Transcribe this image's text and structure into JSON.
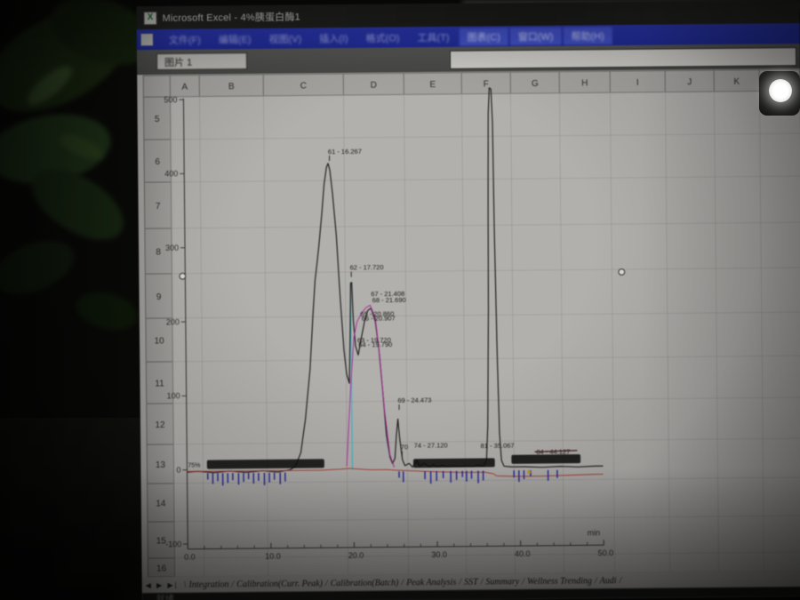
{
  "window": {
    "title": "Microsoft Excel - 4%胰蛋白酶1",
    "status_ready": "就绪",
    "name_box": "图片 1"
  },
  "menu": {
    "items": [
      "文件(F)",
      "编辑(E)",
      "视图(V)",
      "插入(I)",
      "格式(O)",
      "工具(T)",
      "图表(C)",
      "窗口(W)",
      "帮助(H)"
    ]
  },
  "grid": {
    "columns": [
      "A",
      "B",
      "C",
      "D",
      "E",
      "F",
      "G",
      "H",
      "I",
      "J",
      "K"
    ],
    "rows": [
      "5",
      "6",
      "7",
      "8",
      "9",
      "10",
      "11",
      "12",
      "13",
      "14",
      "15",
      "16"
    ]
  },
  "sheet_tabs": {
    "nav": "◀ ▶ ▶|",
    "lead": "\\",
    "separator": "/",
    "tabs": [
      "Integration",
      "Calibration(Curr. Peak)",
      "Calibration(Batch)",
      "Peak Analysis",
      "SST",
      "Summary",
      "Wellness Trending",
      "Audi"
    ]
  },
  "chart_data": {
    "type": "line",
    "title": "",
    "xlabel": "min",
    "ylabel": "",
    "xlim": [
      0,
      50
    ],
    "ylim": [
      -100,
      500
    ],
    "x_ticks": [
      {
        "v": 0,
        "label": "0.0"
      },
      {
        "v": 10,
        "label": "10.0"
      },
      {
        "v": 20,
        "label": "20.0"
      },
      {
        "v": 30,
        "label": "30.0"
      },
      {
        "v": 40,
        "label": "40.0"
      },
      {
        "v": 50,
        "label": "50.0"
      }
    ],
    "y_ticks": [
      {
        "v": 500,
        "label": "500"
      },
      {
        "v": 400,
        "label": "400"
      },
      {
        "v": 300,
        "label": "300"
      },
      {
        "v": 200,
        "label": "200"
      },
      {
        "v": 100,
        "label": "100"
      },
      {
        "v": 0,
        "label": "0"
      },
      {
        "v": -100,
        "label": "-100"
      }
    ],
    "baseline_fragment_label": "75%",
    "peak_labels": [
      {
        "text": "61 - 16.267",
        "x": 17.3,
        "y": 425,
        "leader": true
      },
      {
        "text": "62 - 17.720",
        "x": 19.8,
        "y": 268,
        "leader": true
      },
      {
        "text": "67 - 21.408",
        "x": 22.3,
        "y": 232
      },
      {
        "text": "68 - 21.690",
        "x": 22.45,
        "y": 224
      },
      {
        "text": "65 - 20.860",
        "x": 21.0,
        "y": 205
      },
      {
        "text": "66 - 20.907",
        "x": 21.15,
        "y": 199
      },
      {
        "text": "63 - 19.720",
        "x": 20.6,
        "y": 170
      },
      {
        "text": "64 - 19.790",
        "x": 20.75,
        "y": 164
      },
      {
        "text": "69 - 24.473",
        "x": 25.4,
        "y": 88,
        "leader": true
      },
      {
        "text": "70",
        "x": 25.7,
        "y": 25,
        "leader": true
      },
      {
        "text": "74 - 27.120",
        "x": 27.3,
        "y": 27
      },
      {
        "text": "81 - 35.067",
        "x": 35.3,
        "y": 26
      },
      {
        "text": "84 - 44.127",
        "x": 42.0,
        "y": 17,
        "strike": true
      }
    ],
    "series": [
      {
        "name": "main-trace",
        "color": "#22201e",
        "width": 1.2,
        "points": [
          [
            0,
            -3
          ],
          [
            1.3,
            -2
          ],
          [
            3.2,
            -4
          ],
          [
            5.1,
            -2
          ],
          [
            7.1,
            -4
          ],
          [
            9.1,
            -2
          ],
          [
            10.9,
            -4
          ],
          [
            12.4,
            -1
          ],
          [
            13.0,
            3
          ],
          [
            13.7,
            22
          ],
          [
            14.3,
            68
          ],
          [
            14.9,
            135
          ],
          [
            15.3,
            206
          ],
          [
            15.6,
            254
          ],
          [
            15.9,
            281
          ],
          [
            16.1,
            301
          ],
          [
            16.5,
            345
          ],
          [
            16.8,
            384
          ],
          [
            17.1,
            407
          ],
          [
            17.3,
            412
          ],
          [
            17.5,
            403
          ],
          [
            17.8,
            371
          ],
          [
            18.2,
            315
          ],
          [
            18.6,
            231
          ],
          [
            19.0,
            160
          ],
          [
            19.3,
            127
          ],
          [
            19.6,
            115
          ],
          [
            19.75,
            180
          ],
          [
            19.87,
            250
          ],
          [
            20.0,
            251
          ],
          [
            20.15,
            200
          ],
          [
            20.4,
            165
          ],
          [
            20.7,
            153
          ],
          [
            21.0,
            171
          ],
          [
            21.5,
            198
          ],
          [
            21.9,
            213
          ],
          [
            22.3,
            216
          ],
          [
            22.8,
            198
          ],
          [
            23.2,
            159
          ],
          [
            23.6,
            105
          ],
          [
            24.0,
            45
          ],
          [
            24.4,
            15
          ],
          [
            24.7,
            6
          ],
          [
            25.0,
            13
          ],
          [
            25.2,
            45
          ],
          [
            25.4,
            66
          ],
          [
            25.6,
            39
          ],
          [
            25.9,
            11
          ],
          [
            26.2,
            3
          ],
          [
            26.7,
            6
          ],
          [
            27.1,
            1
          ],
          [
            27.6,
            10
          ],
          [
            28.0,
            2
          ],
          [
            28.5,
            6
          ],
          [
            29.1,
            1
          ],
          [
            29.6,
            4
          ],
          [
            30.1,
            1
          ],
          [
            30.7,
            3
          ],
          [
            31.3,
            1
          ],
          [
            32.1,
            2
          ],
          [
            32.8,
            1
          ],
          [
            33.5,
            2
          ],
          [
            34.3,
            1
          ],
          [
            35.0,
            3
          ],
          [
            35.6,
            1
          ],
          [
            36.0,
            9
          ],
          [
            36.2,
            57
          ],
          [
            36.4,
            213
          ],
          [
            36.5,
            369
          ],
          [
            36.6,
            477
          ],
          [
            36.75,
            512
          ],
          [
            36.95,
            510
          ],
          [
            37.1,
            465
          ],
          [
            37.2,
            321
          ],
          [
            37.4,
            153
          ],
          [
            37.6,
            45
          ],
          [
            37.8,
            9
          ],
          [
            38.1,
            1
          ],
          [
            39.0,
            0
          ],
          [
            40.6,
            0
          ],
          [
            42.7,
            -1
          ],
          [
            44.9,
            0
          ],
          [
            47.0,
            -1
          ],
          [
            49.1,
            0
          ],
          [
            50,
            0
          ]
        ]
      },
      {
        "name": "secondary-trace",
        "color": "#a8309a",
        "width": 1,
        "points": [
          [
            19.2,
            3
          ],
          [
            19.8,
            117
          ],
          [
            20.2,
            177
          ],
          [
            20.6,
            198
          ],
          [
            21.2,
            210
          ],
          [
            21.7,
            217
          ],
          [
            22.2,
            220
          ],
          [
            22.8,
            203
          ],
          [
            23.3,
            150
          ],
          [
            23.8,
            78
          ],
          [
            24.4,
            18
          ],
          [
            24.9,
            1
          ]
        ]
      },
      {
        "name": "baseline-trace",
        "color": "#a84038",
        "width": 1,
        "points": [
          [
            0,
            -2
          ],
          [
            4,
            -2
          ],
          [
            8,
            -2
          ],
          [
            12,
            -2
          ],
          [
            16,
            -2
          ],
          [
            18.5,
            -1
          ],
          [
            19.5,
            0
          ],
          [
            20.5,
            -1
          ],
          [
            22,
            -2
          ],
          [
            24,
            -2
          ],
          [
            25,
            -3
          ],
          [
            26.7,
            -4
          ],
          [
            28.8,
            -5
          ],
          [
            31,
            -6
          ],
          [
            33.1,
            -7
          ],
          [
            35.8,
            -7
          ],
          [
            36.8,
            -9
          ],
          [
            37.2,
            -12
          ],
          [
            39.5,
            -13
          ],
          [
            42.7,
            -13
          ],
          [
            45.9,
            -12
          ],
          [
            49,
            -11
          ],
          [
            50,
            -11
          ]
        ]
      }
    ],
    "event_marker": {
      "name": "cyan-marker-line",
      "color": "#38b6c6",
      "x": 19.87,
      "y0": -2,
      "y1": 252
    },
    "fraction_ticks": {
      "color": "#23279c",
      "group1": [
        2.4,
        3.0,
        3.6,
        4.2,
        4.8,
        5.4,
        6.1,
        6.7,
        7.3,
        7.9,
        8.5,
        9.2,
        9.8,
        10.4,
        11.1,
        11.7
      ],
      "group2": [
        25.4,
        25.9,
        28.5,
        29.2,
        29.9,
        30.7,
        31.6,
        32.3,
        33.0,
        33.5,
        34.1,
        34.9,
        35.5,
        39.2,
        39.8,
        40.4,
        41.2,
        43.3,
        44.4
      ]
    },
    "yellow_dot": {
      "x": 41.1,
      "color": "#c09a22"
    },
    "strikeout_bars": [
      {
        "x0": 2.4,
        "x1": 16.5,
        "y": 7
      },
      {
        "x0": 27.2,
        "x1": 37.0,
        "y": 6
      },
      {
        "x0": 39.0,
        "x1": 47.3,
        "y": 10
      }
    ]
  }
}
